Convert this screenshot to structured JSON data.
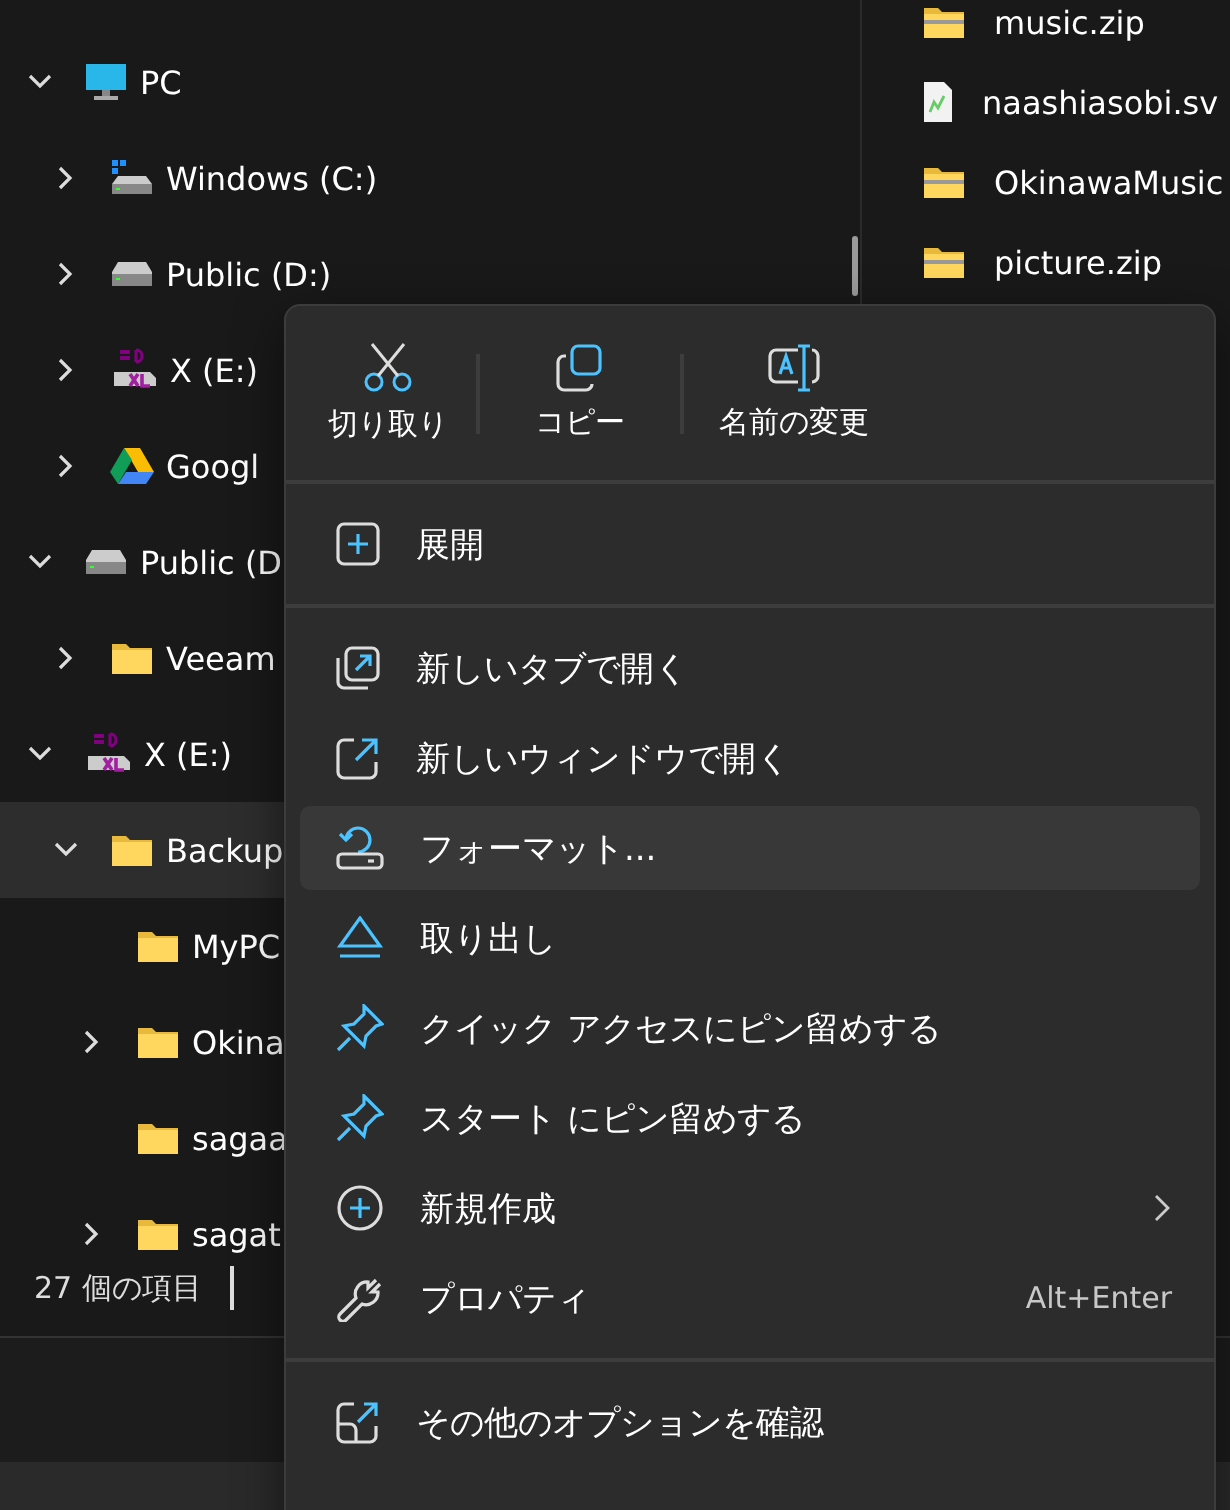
{
  "tree": [
    {
      "label": "PC",
      "kind": "monitor",
      "expandable": true,
      "expanded": true,
      "selected": false,
      "children": [
        {
          "label": "Windows (C:)",
          "kind": "system-drive",
          "expandable": true,
          "expanded": false,
          "selected": false
        },
        {
          "label": "Public (D:)",
          "kind": "drive",
          "expandable": true,
          "expanded": false,
          "selected": false
        },
        {
          "label": "X (E:)",
          "kind": "sd-card",
          "expandable": true,
          "expanded": false,
          "selected": false
        },
        {
          "label": "Googl",
          "kind": "cloud-drive",
          "expandable": true,
          "expanded": false,
          "selected": false
        }
      ]
    },
    {
      "label": "Public (D",
      "kind": "drive",
      "expandable": true,
      "expanded": true,
      "selected": false,
      "children": [
        {
          "label": "Veeam",
          "kind": "folder",
          "expandable": true,
          "expanded": false,
          "selected": false
        }
      ]
    },
    {
      "label": "X (E:)",
      "kind": "sd-card",
      "expandable": true,
      "expanded": true,
      "selected": false,
      "children": [
        {
          "label": "Backup",
          "kind": "folder",
          "expandable": true,
          "expanded": true,
          "selected": true,
          "children": [
            {
              "label": "MyPC",
              "kind": "folder",
              "selected": false
            },
            {
              "label": "Okina",
              "kind": "folder",
              "expandable": true,
              "expanded": false,
              "selected": false
            },
            {
              "label": "sagaa",
              "kind": "folder",
              "selected": false
            },
            {
              "label": "sagat",
              "kind": "folder",
              "expandable": true,
              "expanded": false,
              "selected": false
            }
          ]
        }
      ]
    }
  ],
  "files": [
    {
      "name": "music.zip",
      "kind": "zip"
    },
    {
      "name": "naashiasobi.sv",
      "kind": "svg"
    },
    {
      "name": "OkinawaMusic",
      "kind": "zip"
    },
    {
      "name": "picture.zip",
      "kind": "zip"
    }
  ],
  "status_bar": {
    "item_count": "27 個の項目"
  },
  "context_menu": {
    "toolbar": [
      {
        "label": "切り取り",
        "kind": "cut"
      },
      {
        "label": "コピー",
        "kind": "copy"
      },
      {
        "label": "名前の変更",
        "kind": "rename"
      }
    ],
    "groups": [
      [
        {
          "label": "展開",
          "kind": "expand",
          "selected": false
        }
      ],
      [
        {
          "label": "新しいタブで開く",
          "kind": "new-tab",
          "selected": false
        },
        {
          "label": "新しいウィンドウで開く",
          "kind": "new-window",
          "selected": false
        },
        {
          "label": "フォーマット...",
          "kind": "format",
          "selected": true
        },
        {
          "label": "取り出し",
          "kind": "eject",
          "selected": false
        },
        {
          "label": "クイック アクセスにピン留めする",
          "kind": "pin",
          "selected": false
        },
        {
          "label": "スタート にピン留めする",
          "kind": "pin",
          "selected": false
        },
        {
          "label": "新規作成",
          "kind": "new",
          "selected": false,
          "submenu": true
        },
        {
          "label": "プロパティ",
          "kind": "properties",
          "selected": false,
          "shortcut": "Alt+Enter"
        }
      ],
      [
        {
          "label": "その他のオプションを確認",
          "kind": "more",
          "selected": false
        }
      ]
    ]
  }
}
